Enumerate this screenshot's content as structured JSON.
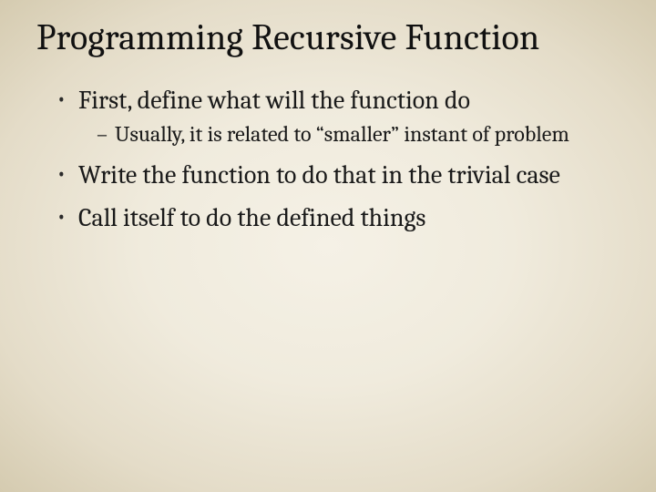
{
  "slide": {
    "title": "Programming Recursive Function",
    "bullets": [
      {
        "text": "First, define what will the function do",
        "sub": [
          "Usually, it is related to “smaller” instant of problem"
        ]
      },
      {
        "text": "Write the function to do that in the trivial case",
        "sub": []
      },
      {
        "text": "Call itself to do the defined things",
        "sub": []
      }
    ]
  }
}
